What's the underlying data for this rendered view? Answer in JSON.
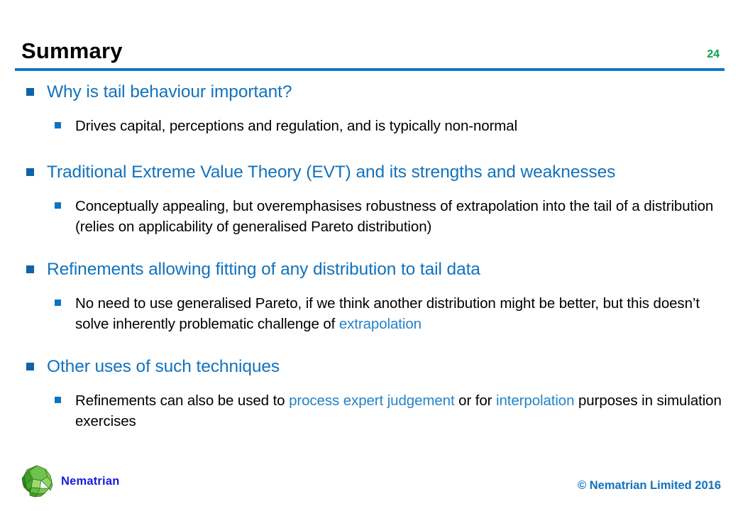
{
  "slide": {
    "title": "Summary",
    "page_number": "24",
    "accent_blue": "#1272bd",
    "rule_blue": "#1277c4",
    "page_number_green": "#00a550",
    "link_blue": "#2484c6",
    "body_black": "#000000"
  },
  "bullets": [
    {
      "level": 1,
      "text": "Why is tail behaviour important?"
    },
    {
      "level": 2,
      "text": "Drives capital, perceptions and regulation, and is typically non-normal"
    },
    {
      "level": 1,
      "text": "Traditional Extreme Value Theory (EVT) and its strengths and weaknesses"
    },
    {
      "level": 2,
      "text": "Conceptually appealing, but overemphasises robustness of extrapolation into the tail of a distribution (relies on applicability of generalised Pareto distribution)"
    },
    {
      "level": 1,
      "text": "Refinements allowing fitting of any distribution to tail data"
    },
    {
      "level": 2,
      "runs": [
        {
          "text": "No need to use generalised Pareto, if we think another distribution might be better, but this doesn’t solve inherently problematic challenge of ",
          "style": "plain"
        },
        {
          "text": "extrapolation",
          "style": "link"
        }
      ]
    },
    {
      "level": 1,
      "text": "Other uses of such techniques"
    },
    {
      "level": 2,
      "runs": [
        {
          "text": "Refinements can also be used to ",
          "style": "plain"
        },
        {
          "text": "process expert judgement",
          "style": "link"
        },
        {
          "text": " or for ",
          "style": "plain"
        },
        {
          "text": "interpolation",
          "style": "link"
        },
        {
          "text": " purposes in simulation exercises",
          "style": "plain"
        }
      ]
    }
  ],
  "footer": {
    "logo_text": "Nematrian",
    "logo_icon": "green-polyhedron-icon",
    "copyright": "© Nematrian Limited 2016"
  }
}
